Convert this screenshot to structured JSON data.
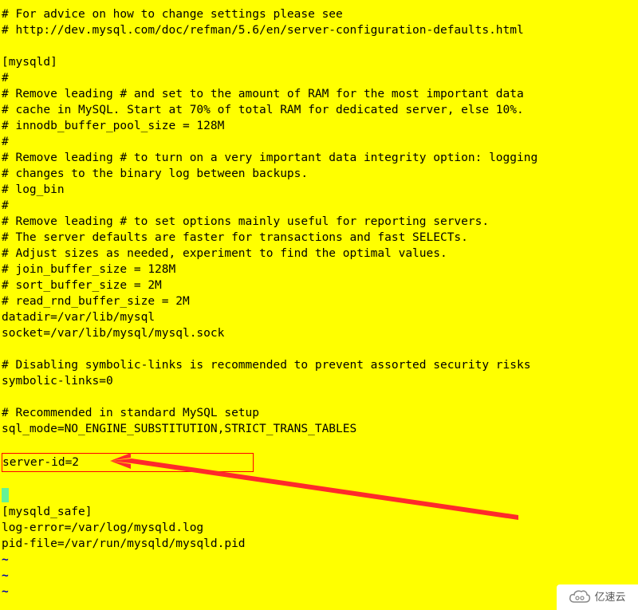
{
  "config": {
    "lines_top": [
      "# For advice on how to change settings please see",
      "# http://dev.mysql.com/doc/refman/5.6/en/server-configuration-defaults.html",
      "",
      "[mysqld]",
      "#",
      "# Remove leading # and set to the amount of RAM for the most important data",
      "# cache in MySQL. Start at 70% of total RAM for dedicated server, else 10%.",
      "# innodb_buffer_pool_size = 128M",
      "#",
      "# Remove leading # to turn on a very important data integrity option: logging",
      "# changes to the binary log between backups.",
      "# log_bin",
      "#",
      "# Remove leading # to set options mainly useful for reporting servers.",
      "# The server defaults are faster for transactions and fast SELECTs.",
      "# Adjust sizes as needed, experiment to find the optimal values.",
      "# join_buffer_size = 128M",
      "# sort_buffer_size = 2M",
      "# read_rnd_buffer_size = 2M",
      "datadir=/var/lib/mysql",
      "socket=/var/lib/mysql/mysql.sock",
      "",
      "# Disabling symbolic-links is recommended to prevent assorted security risks",
      "symbolic-links=0",
      "",
      "# Recommended in standard MySQL setup",
      "sql_mode=NO_ENGINE_SUBSTITUTION,STRICT_TRANS_TABLES",
      ""
    ],
    "highlighted": "server-id=2",
    "lines_bottom": [
      "",
      "",
      "[mysqld_safe]",
      "log-error=/var/log/mysqld.log",
      "pid-file=/var/run/mysqld/mysqld.pid"
    ],
    "tilde": "~"
  },
  "watermark": {
    "text": "亿速云"
  }
}
